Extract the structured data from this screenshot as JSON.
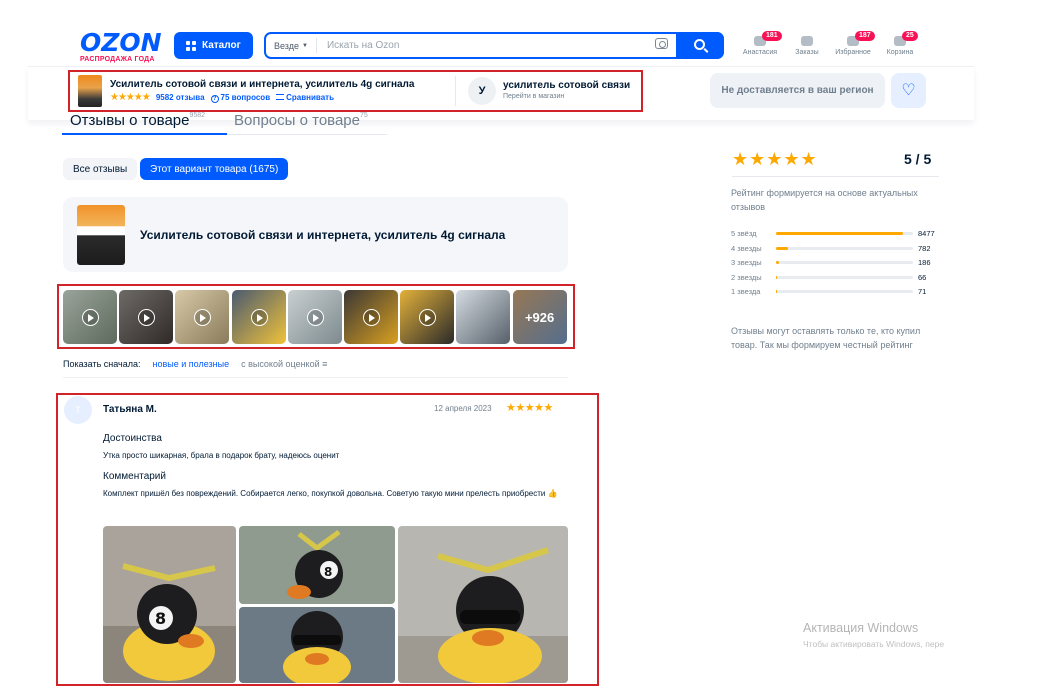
{
  "header": {
    "logo": "OZON",
    "logo_sub": "РАСПРОДАЖА ГОДА",
    "catalog_label": "Каталог",
    "search_scope": "Везде",
    "search_placeholder": "Искать на Ozon",
    "nav": [
      {
        "label": "Анастасия",
        "badge": "181",
        "icon": "user-icon"
      },
      {
        "label": "Заказы",
        "badge": "",
        "icon": "box-icon"
      },
      {
        "label": "Избранное",
        "badge": "187",
        "icon": "heart-icon"
      },
      {
        "label": "Корзина",
        "badge": "25",
        "icon": "cart-icon"
      }
    ]
  },
  "sticky": {
    "title": "Усилитель сотовой связи и интернета, усилитель 4g сигнала",
    "reviews_count": "9582 отзыва",
    "questions": "75 вопросов",
    "compare": "Сравнивать",
    "seller_initial": "У",
    "seller_name": "усилитель сотовой связи",
    "seller_link": "Перейти в магазин",
    "delivery_note": "Не доставляется в ваш регион"
  },
  "tabs": {
    "reviews": "Отзывы о товаре",
    "reviews_count": "9582",
    "questions": "Вопросы о товаре",
    "questions_count": "75"
  },
  "filters": {
    "all": "Все отзывы",
    "variant": "Этот вариант товара (1675)"
  },
  "product_card": {
    "title": "Усилитель сотовой связи и интернета, усилитель 4g сигнала"
  },
  "media": {
    "more_label": "+926",
    "items": [
      {
        "colors": [
          "#9aa39a",
          "#5d6a5c"
        ],
        "video": true
      },
      {
        "colors": [
          "#6e6a66",
          "#2f2a28"
        ],
        "video": true
      },
      {
        "colors": [
          "#d7c9a8",
          "#8a7b5a"
        ],
        "video": true
      },
      {
        "colors": [
          "#4a5a70",
          "#f0c23a"
        ],
        "video": true
      },
      {
        "colors": [
          "#c9cfd1",
          "#7d8a8e"
        ],
        "video": true
      },
      {
        "colors": [
          "#3b3735",
          "#d9a020"
        ],
        "video": true
      },
      {
        "colors": [
          "#e3b13a",
          "#2a2a2a"
        ],
        "video": true
      },
      {
        "colors": [
          "#d5dbe1",
          "#56606a"
        ],
        "video": false
      },
      {
        "colors": [
          "#f2a040",
          "#7a8fa8"
        ],
        "video": false
      }
    ]
  },
  "sort": {
    "label": "Показать сначала:",
    "option_active": "новые и полезные",
    "option_other": "с высокой оценкой"
  },
  "review": {
    "avatar_letter": "Т",
    "author": "Татьяна М.",
    "date": "12 апреля 2023",
    "stars": "★★★★★",
    "pros_title": "Достоинства",
    "pros_text": "Утка просто шикарная, брала в подарок брату, надеюсь оценит",
    "comment_title": "Комментарий",
    "comment_text": "Комплект пришёл без повреждений. Собирается легко, покупкой довольна. Советую такую мини прелесть приобрести 👍"
  },
  "rating_panel": {
    "stars": "★★★★★",
    "value": "5 / 5",
    "note": "Рейтинг формируется на основе актуальных отзывов",
    "distribution": [
      {
        "label": "5 звёзд",
        "count": "8477",
        "fraction": 0.93
      },
      {
        "label": "4 звезды",
        "count": "782",
        "fraction": 0.09
      },
      {
        "label": "3 звезды",
        "count": "186",
        "fraction": 0.02
      },
      {
        "label": "2 звезды",
        "count": "66",
        "fraction": 0.01
      },
      {
        "label": "1 звезда",
        "count": "71",
        "fraction": 0.01
      }
    ],
    "footer_note": "Отзывы могут оставлять только те, кто купил товар. Так мы формируем честный рейтинг"
  },
  "watermark": {
    "line1": "Активация Windows",
    "line2": "Чтобы активировать Windows, пере"
  },
  "colors": {
    "accent": "#005bff",
    "star": "#ffa800",
    "badge": "#f91155",
    "highlight_frame": "#d3232a"
  }
}
